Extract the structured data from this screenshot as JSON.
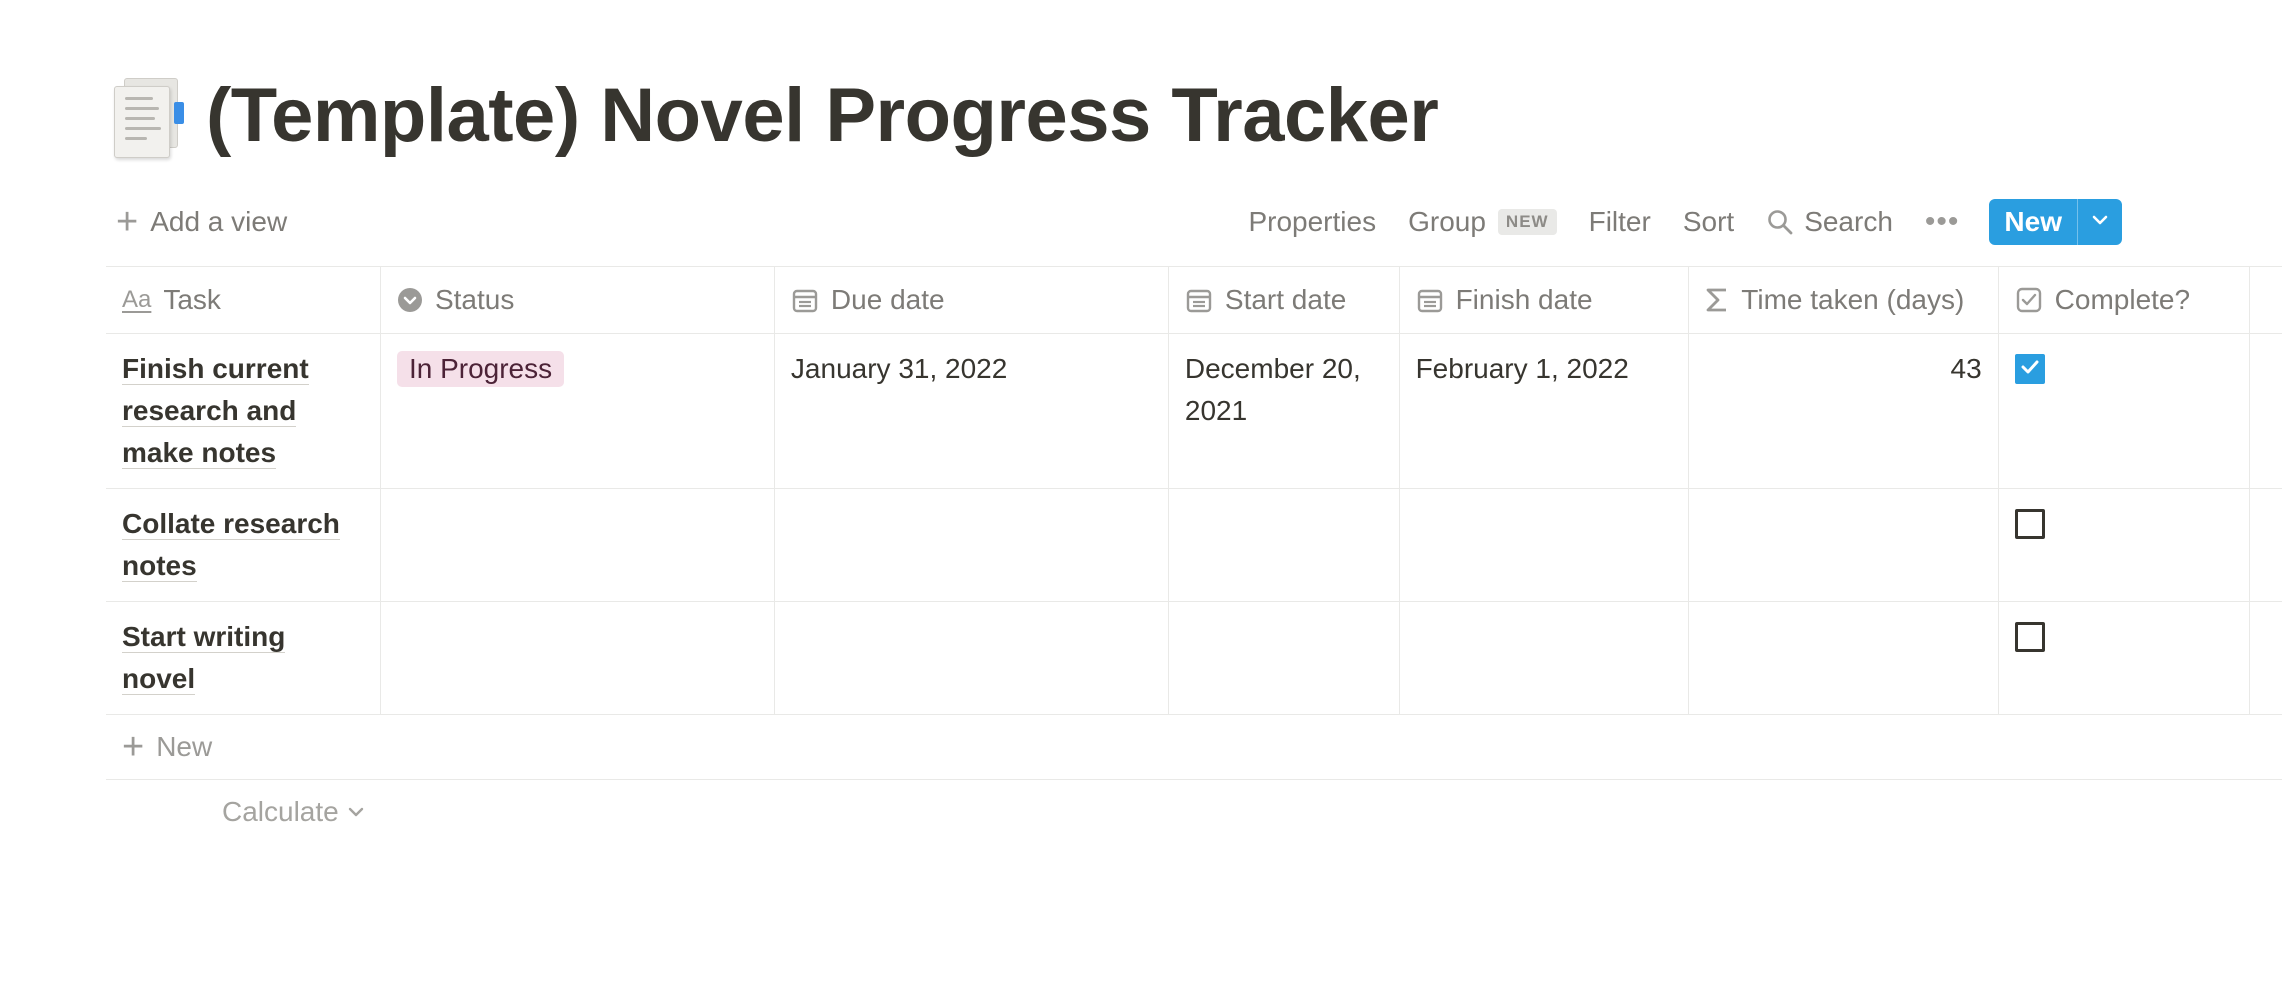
{
  "page": {
    "title": "(Template) Novel Progress Tracker",
    "icon": "page-icon"
  },
  "toolbar": {
    "add_view": "Add a view",
    "properties": "Properties",
    "group": "Group",
    "group_badge": "NEW",
    "filter": "Filter",
    "sort": "Sort",
    "search": "Search",
    "more": "•••",
    "new_button": "New",
    "accent_color": "#2a9ee0"
  },
  "table": {
    "columns": [
      {
        "label": "Task",
        "icon": "title-aa-icon"
      },
      {
        "label": "Status",
        "icon": "status-icon"
      },
      {
        "label": "Due date",
        "icon": "calendar-icon"
      },
      {
        "label": "Start date",
        "icon": "calendar-icon"
      },
      {
        "label": "Finish date",
        "icon": "calendar-icon"
      },
      {
        "label": "Time taken (days)",
        "icon": "sigma-icon"
      },
      {
        "label": "Complete?",
        "icon": "checkbox-icon"
      }
    ],
    "rows": [
      {
        "task": "Finish current research and make notes",
        "status": "In Progress",
        "due_date": "January 31, 2022",
        "start_date": "December 20, 2021",
        "finish_date": "February 1, 2022",
        "time_taken": "43",
        "complete": true
      },
      {
        "task": "Collate research notes",
        "status": "",
        "due_date": "",
        "start_date": "",
        "finish_date": "",
        "time_taken": "",
        "complete": false
      },
      {
        "task": "Start writing novel",
        "status": "",
        "due_date": "",
        "start_date": "",
        "finish_date": "",
        "time_taken": "",
        "complete": false
      }
    ],
    "new_row": "New",
    "calculate": "Calculate",
    "status_tag_color": "#f5e0e9"
  }
}
